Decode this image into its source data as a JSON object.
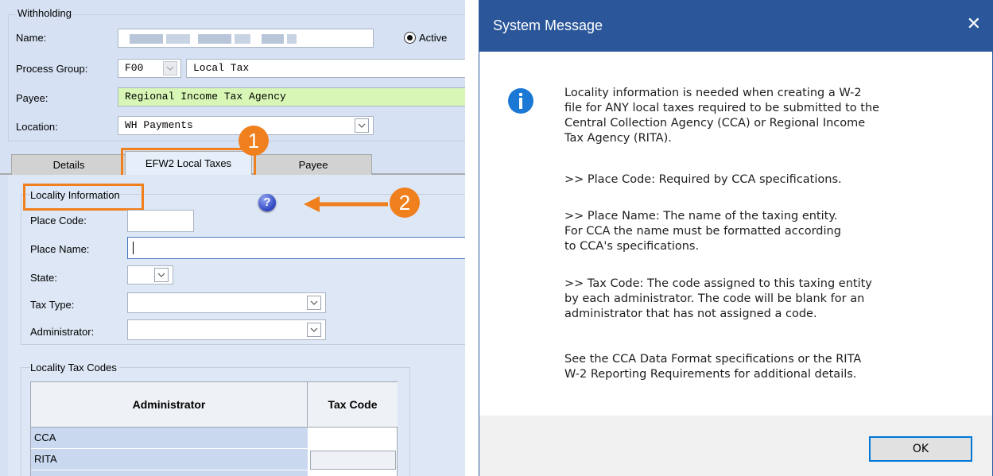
{
  "form": {
    "withholding_legend": "Withholding",
    "name_label": "Name:",
    "name_value": "",
    "active_label": "Active",
    "process_group_label": "Process Group:",
    "process_group_code": "F00",
    "process_group_name": "Local Tax",
    "payee_label": "Payee:",
    "payee_value": "Regional Income Tax Agency",
    "location_label": "Location:",
    "location_value": "WH Payments",
    "tabs": [
      {
        "label": "Details"
      },
      {
        "label": "EFW2 Local Taxes"
      },
      {
        "label": "Payee"
      }
    ],
    "locality_legend": "Locality Information",
    "help_icon_glyph": "?",
    "place_code_label": "Place Code:",
    "place_code_value": "",
    "place_name_label": "Place Name:",
    "place_name_value": "",
    "state_label": "State:",
    "tax_type_label": "Tax Type:",
    "administrator_label": "Administrator:",
    "codes_legend": "Locality Tax Codes",
    "table": {
      "columns": [
        "Administrator",
        "Tax Code"
      ],
      "rows": [
        {
          "administrator": "CCA",
          "tax_code": ""
        },
        {
          "administrator": "RITA",
          "tax_code": ""
        }
      ]
    }
  },
  "annotations": {
    "callout_1": "1",
    "callout_2": "2",
    "highlight_color": "#f07f1d"
  },
  "dialog": {
    "title": "System Message",
    "close_glyph": "✕",
    "info_icon": "info-icon",
    "paragraphs": [
      "Locality information is needed when creating a W-2\nfile for ANY local taxes required to be submitted to the\nCentral Collection Agency (CCA) or Regional Income\nTax Agency (RITA).",
      ">> Place Code: Required by CCA specifications.",
      ">> Place Name: The name of the taxing entity.\nFor CCA the name must be formatted according\nto CCA's specifications.",
      ">> Tax Code: The code assigned to this taxing entity\nby each administrator. The code will be blank for an\nadministrator that has not assigned a code.",
      "See the CCA Data Format specifications or the RITA\nW-2 Reporting Requirements for additional details."
    ],
    "ok_label": "OK",
    "titlebar_color": "#2b579a"
  }
}
